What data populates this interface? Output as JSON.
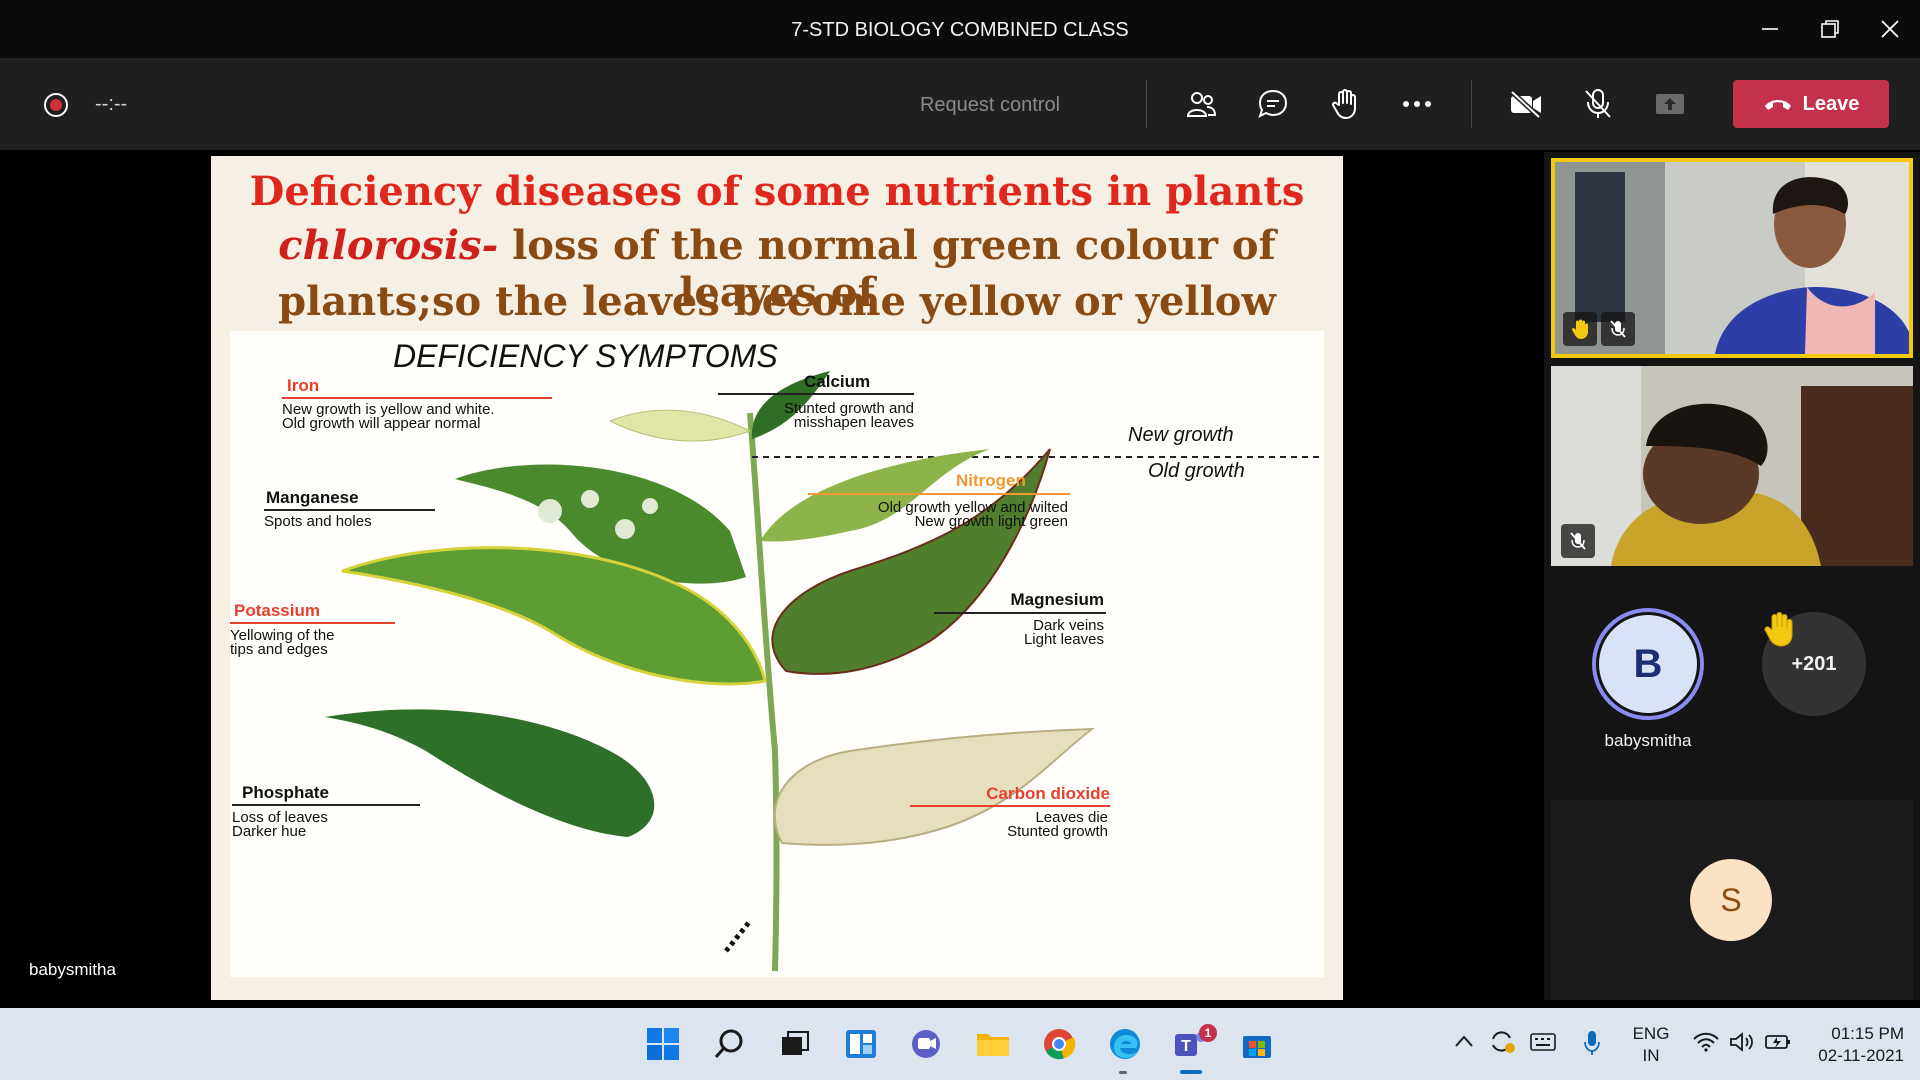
{
  "window": {
    "title": "7-STD BIOLOGY COMBINED CLASS"
  },
  "toolbar": {
    "recording_time": "--:--",
    "request_control_label": "Request control",
    "leave_label": "Leave"
  },
  "slide": {
    "title": "Deficiency diseases of some nutrients in plants",
    "line2_term": "chlorosis-",
    "line2_rest": " loss of the normal green colour of leaves of",
    "line3": "plants;so the leaves become yellow or yellow white.",
    "diagram": {
      "heading": "DEFICIENCY SYMPTOMS",
      "new_growth": "New growth",
      "old_growth": "Old growth",
      "labels": {
        "iron": {
          "name": "Iron",
          "line1": "New growth is yellow and white.",
          "line2": "Old growth will appear normal"
        },
        "calcium": {
          "name": "Calcium",
          "line1": "Stunted growth and",
          "line2": "misshapen leaves"
        },
        "manganese": {
          "name": "Manganese",
          "line1": "Spots and holes"
        },
        "nitrogen": {
          "name": "Nitrogen",
          "line1": "Old growth yellow and wilted",
          "line2": "New growth light green"
        },
        "potassium": {
          "name": "Potassium",
          "line1": "Yellowing of the",
          "line2": "tips and edges"
        },
        "magnesium": {
          "name": "Magnesium",
          "line1": "Dark veins",
          "line2": "Light leaves"
        },
        "phosphate": {
          "name": "Phosphate",
          "line1": "Loss of leaves",
          "line2": "Darker hue"
        },
        "carbon_dioxide": {
          "name": "Carbon dioxide",
          "line1": "Leaves die",
          "line2": "Stunted growth"
        }
      }
    }
  },
  "presenter_name": "babysmitha",
  "participants": {
    "avatar_b_initial": "B",
    "avatar_b_name": "babysmitha",
    "overflow_count": "+201",
    "self_initial": "S"
  },
  "taskbar": {
    "teams_badge": "1",
    "lang_line1": "ENG",
    "lang_line2": "IN",
    "time": "01:15 PM",
    "date": "02-11-2021"
  },
  "colors": {
    "leave_red": "#c4314b",
    "active_speaker": "#f2c811",
    "avatar_ring": "#8b8cf2"
  }
}
